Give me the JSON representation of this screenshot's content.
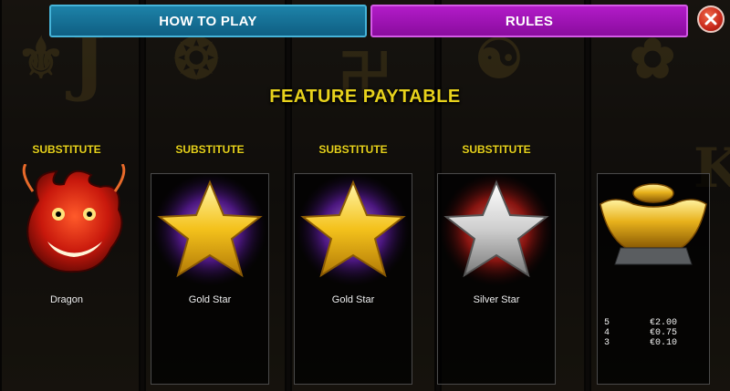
{
  "tabs": {
    "how_to_play": "HOW TO PLAY",
    "rules": "RULES"
  },
  "close_label": "X",
  "title": "FEATURE PAYTABLE",
  "symbols": [
    {
      "header": "SUBSTITUTE",
      "name": "Dragon",
      "icon": "dragon-icon"
    },
    {
      "header": "SUBSTITUTE",
      "name": "Gold Star",
      "icon": "gold-star-icon"
    },
    {
      "header": "SUBSTITUTE",
      "name": "Gold Star",
      "icon": "gold-star-icon"
    },
    {
      "header": "SUBSTITUTE",
      "name": "Silver Star",
      "icon": "silver-star-icon"
    },
    {
      "header": "",
      "name": "",
      "icon": "gold-ingot-icon"
    }
  ],
  "ingot_payouts": [
    {
      "count": "5",
      "amount": "€2.00"
    },
    {
      "count": "4",
      "amount": "€0.75"
    },
    {
      "count": "3",
      "amount": "€0.10"
    }
  ],
  "colors": {
    "title": "#e8d21c",
    "tab_how_to_play": "#0f5f83",
    "tab_rules": "#8a0c9e",
    "close": "#c8281a"
  }
}
